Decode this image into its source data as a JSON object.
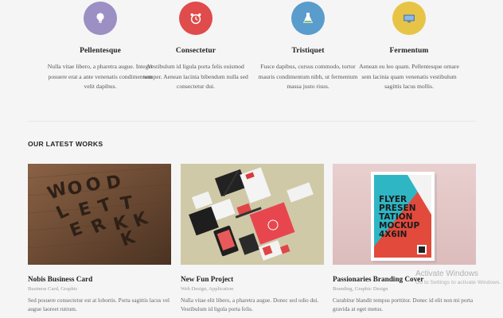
{
  "features": [
    {
      "title": "Pellentesque",
      "description": "Nulla vitae libero, a pharetra augue. Integer posuere erat a ante venenatis condimentum velit dapibus.",
      "icon": "lightbulb-icon",
      "color": "#9b8fc4"
    },
    {
      "title": "Consectetur",
      "description": "Vestibulum id ligula porta felis euismod semper. Aenean lacinia bibendum nulla sed consectetur dui.",
      "icon": "alarm-clock-icon",
      "color": "#e04b4b"
    },
    {
      "title": "Tristiquet",
      "description": "Fusce dapibus, cursus commodo, tortor mauris condimentum nibh, ut fermentum massa justo risus.",
      "icon": "flask-icon",
      "color": "#5a9ccc"
    },
    {
      "title": "Fermentum",
      "description": "Aenean eu leo quam. Pellentesque ornare sem lacinia quam venenatis vestibulum sagittis lacus mollis.",
      "icon": "monitor-icon",
      "color": "#e8c446"
    }
  ],
  "section": {
    "title": "OUR LATEST WORKS"
  },
  "works": [
    {
      "title": "Nobis Business Card",
      "categories": "Business Card, Graphic",
      "description": "Sed posuere consectetur est at lobortis. Porta sagittis lacus vel augue laoreet rutrum.",
      "image": "3d-wood-letters"
    },
    {
      "title": "New Fun Project",
      "categories": "Web Design, Application",
      "description": "Nulla vitae elit libero, a pharetra augue. Donec sed odio dui. Vestibulum id ligula porta felis.",
      "image": "stationery-mockup"
    },
    {
      "title": "Passionaries Branding Cover",
      "categories": "Branding, Graphic Design",
      "description": "Curabitur blandit tempus porttitor. Donec id elit non mi porta gravida at eget metus.",
      "image": "flyer-mockup",
      "poster_text": [
        "FLYER",
        "PRESEN",
        "TATION",
        "MOCKUP",
        "4X6IN"
      ]
    }
  ],
  "wood_letters": [
    "W",
    "O",
    "O",
    "D",
    "L",
    "E",
    "T",
    "T",
    "E",
    "R",
    "K",
    "K",
    "K"
  ],
  "watermark": {
    "line1": "Activate Windows",
    "line2": "Go to Settings to activate Windows."
  }
}
